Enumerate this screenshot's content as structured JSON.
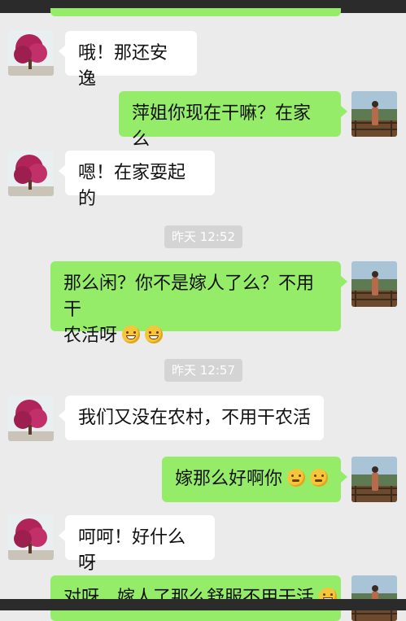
{
  "messages": [
    {
      "side": "left",
      "text": "哦！那还安逸",
      "emojis": []
    },
    {
      "side": "right",
      "text": "萍姐你现在干嘛？在家么",
      "emojis": []
    },
    {
      "side": "left",
      "text": "嗯！在家耍起的",
      "emojis": []
    },
    {
      "side": "right",
      "line1": "那么闲？你不是嫁人了么？不用干",
      "line2": "农活呀",
      "emojis": [
        "grin-icon",
        "grin-icon"
      ]
    },
    {
      "side": "left",
      "text": "我们又没在农村，不用干农活",
      "emojis": []
    },
    {
      "side": "right",
      "text": "嫁那么好啊你",
      "emojis": [
        "thinking-icon",
        "thinking-icon"
      ]
    },
    {
      "side": "left",
      "text": "呵呵！好什么呀",
      "emojis": []
    },
    {
      "side": "right",
      "text": "对呀，嫁人了那么舒服不用干活",
      "emojis": [
        "grin-icon"
      ]
    }
  ],
  "timestamps": [
    "昨天 12:52",
    "昨天 12:57"
  ],
  "colors": {
    "background": "#ebebeb",
    "bubble_right": "#95ec69",
    "bubble_left": "#ffffff",
    "timestamp_bg": "#d4d4d4"
  },
  "avatars": {
    "left": "pink-tree-avatar",
    "right": "person-on-balcony-avatar"
  }
}
